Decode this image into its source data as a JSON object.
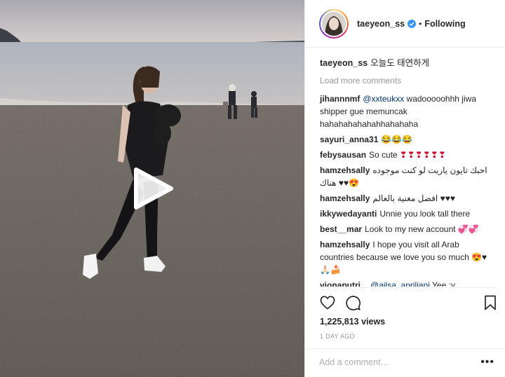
{
  "header": {
    "username": "taeyeon_ss",
    "separator": "•",
    "follow_label": "Following"
  },
  "caption": {
    "username": "taeyeon_ss",
    "text": "오늘도 태연하게"
  },
  "load_more_label": "Load more comments",
  "comments": [
    {
      "user": "jihannnmf",
      "mention": "@xxteukxx",
      "text": " wadooooohhh jiwa shipper gue memuncak hahahahahahahhahahaha"
    },
    {
      "user": "sayuri_anna31",
      "text": "😂😂😂"
    },
    {
      "user": "febysausan",
      "text": "So cute ",
      "hearts": "❣❣❣❣❣❣"
    },
    {
      "user": "hamzehsally",
      "text": "احبك تايون ياريت لو كنت موجوده هناك ♥♥😍"
    },
    {
      "user": "hamzehsally",
      "text": "افضل مغنية بالعالم ♥♥♥"
    },
    {
      "user": "ikkywedayanti",
      "text": "Unnie you look tall there"
    },
    {
      "user": "best__mar",
      "text": "Look to my new account 💞💞"
    },
    {
      "user": "hamzehsally",
      "text": "I hope you visit all Arab countries because we love you so much 😍♥🙏🏻🍰"
    },
    {
      "user": "vionaputri._",
      "mention": "@ailsa_apriliani",
      "text": " Yee :v"
    }
  ],
  "views": "1,225,813 views",
  "time_ago": "1 DAY AGO",
  "add_comment_placeholder": "Add a comment…",
  "more_label": "•••",
  "icons": {
    "play": "play-icon",
    "like": "heart-icon",
    "comment": "comment-icon",
    "save": "bookmark-icon",
    "verified": "verified-badge-icon"
  },
  "colors": {
    "link": "#003569",
    "verified": "#3897f0",
    "muted": "#999999"
  }
}
